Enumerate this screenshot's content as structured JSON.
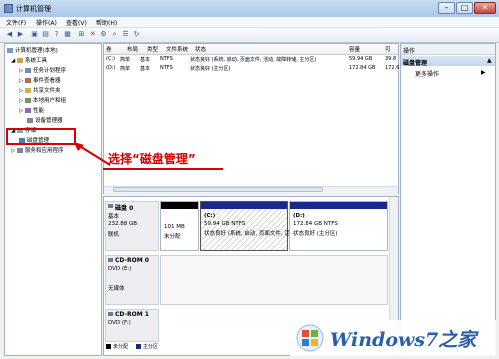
{
  "window": {
    "title": "计算机管理"
  },
  "menu": [
    "文件(F)",
    "操作(A)",
    "查看(V)",
    "帮助(H)"
  ],
  "tree": {
    "root": "计算机管理(本地)",
    "system_tools": "系统工具",
    "items": [
      "任务计划程序",
      "事件查看器",
      "共享文件夹",
      "本地用户和组",
      "性能",
      "设备管理器"
    ],
    "storage": "存储",
    "disk_management": "磁盘管理",
    "services": "服务和应用程序"
  },
  "columns": [
    "卷",
    "布局",
    "类型",
    "文件系统",
    "状态",
    "容量",
    "可"
  ],
  "volumes": [
    {
      "vol": "(C:)",
      "layout": "简单",
      "type": "基本",
      "fs": "NTFS",
      "status": "状态良好 (系统, 启动, 页面文件, 活动, 故障转储, 主分区)",
      "size": "59.94 GB",
      "free": "39.8"
    },
    {
      "vol": "(D:)",
      "layout": "简单",
      "type": "基本",
      "fs": "NTFS",
      "status": "状态良好 (主分区)",
      "size": "172.84 GB",
      "free": "172.6"
    }
  ],
  "callout": "选择“磁盘管理”",
  "disks": [
    {
      "name": "磁盘 0",
      "info": [
        "基本",
        "232.88 GB",
        "联机"
      ]
    },
    {
      "name": "CD-ROM 0",
      "info": [
        "DVD (E:)",
        "",
        "无媒体"
      ]
    },
    {
      "name": "CD-ROM 1",
      "info": [
        "DVD (F:)"
      ]
    }
  ],
  "partitions": [
    {
      "title": "",
      "line1": "101 MB",
      "line2": "未分配"
    },
    {
      "title": "(C:)",
      "line1": "59.94 GB NTFS",
      "line2": "状态良好 (系统, 启动, 页面文件, 活动"
    },
    {
      "title": "(D:)",
      "line1": "172.84 GB NTFS",
      "line2": "状态良好 (主分区)"
    }
  ],
  "legend": [
    "未分配",
    "主分区"
  ],
  "actions": {
    "header": "操作",
    "section": "磁盘管理",
    "more": "更多操作"
  },
  "watermark": "Windows7之家",
  "colors": {
    "callout": "#d60000",
    "unallocated": "#000000",
    "primary": "#1a2a8c",
    "selection": "#c3d6ee"
  }
}
